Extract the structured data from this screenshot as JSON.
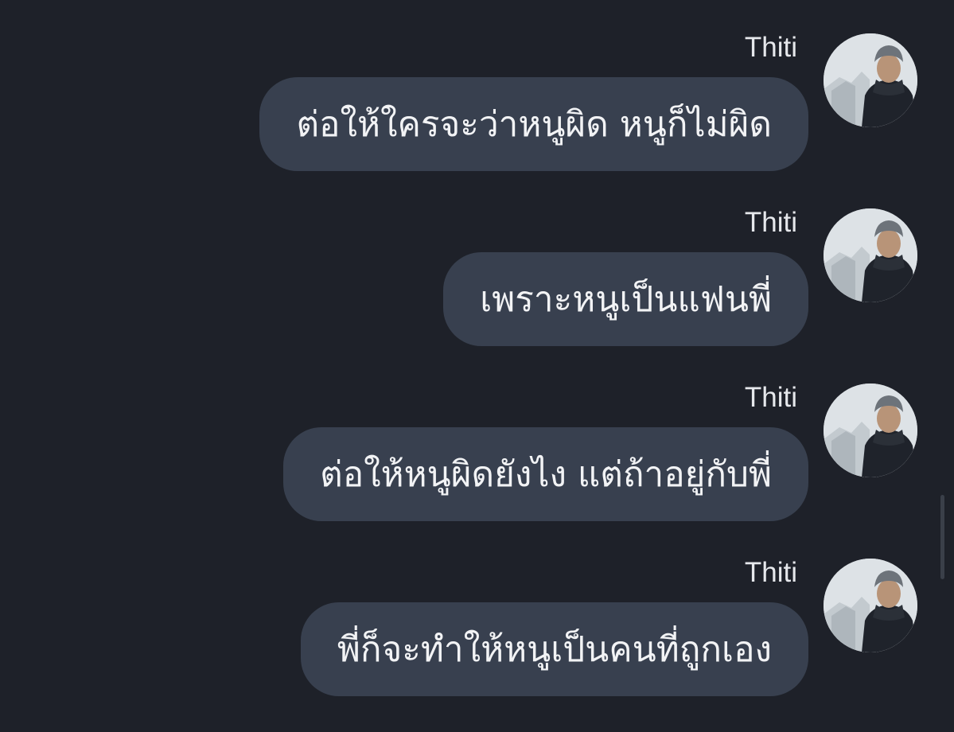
{
  "messages": [
    {
      "sender": "Thiti",
      "text": "ต่อให้ใครจะว่าหนูผิด หนูก็ไม่ผิด"
    },
    {
      "sender": "Thiti",
      "text": "เพราะหนูเป็นแฟนพี่"
    },
    {
      "sender": "Thiti",
      "text": "ต่อให้หนูผิดยังไง แต่ถ้าอยู่กับพี่"
    },
    {
      "sender": "Thiti",
      "text": "พี่ก็จะทำให้หนูเป็นคนที่ถูกเอง"
    }
  ],
  "colors": {
    "background": "#1e2129",
    "bubble": "#38404f",
    "text": "#f2f3f5"
  },
  "icons": {
    "avatar": "profile-photo"
  }
}
